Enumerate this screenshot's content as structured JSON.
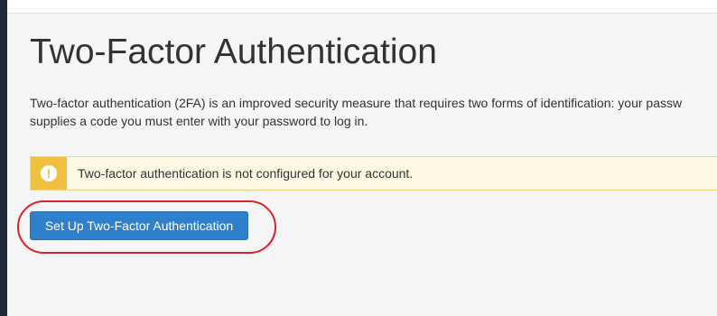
{
  "page": {
    "title": "Two-Factor Authentication",
    "description_line1": "Two-factor authentication (2FA) is an improved security measure that requires two forms of identification: your passw",
    "description_line2": "supplies a code you must enter with your password to log in."
  },
  "alert": {
    "icon": "exclamation-icon",
    "icon_glyph": "!",
    "message": "Two-factor authentication is not configured for your account.",
    "color": "#f0c040"
  },
  "actions": {
    "setup_label": "Set Up Two-Factor Authentication",
    "accent_color": "#2f80cc",
    "highlight_color": "#d9232e"
  }
}
